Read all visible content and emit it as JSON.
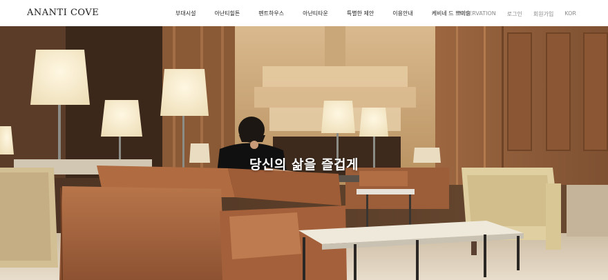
{
  "brand": {
    "logo_text": "ANANTI COVE"
  },
  "nav": {
    "items": [
      {
        "label": "부대시설"
      },
      {
        "label": "아난티힐튼"
      },
      {
        "label": "펜트하우스"
      },
      {
        "label": "아난티타운"
      },
      {
        "label": "특별한 제안"
      },
      {
        "label": "이용안내"
      },
      {
        "label": "케비네 드 쁘이송"
      }
    ]
  },
  "utility": {
    "reservation": "RESERVATION",
    "login": "로그인",
    "signup": "회원가입",
    "language": "KOR"
  },
  "hero": {
    "tagline": "당신의 삶을 즐겁게"
  },
  "colors": {
    "header_bg": "#ffffff",
    "nav_text": "#222222",
    "utility_text": "#8a8a8a",
    "wood": "#8a5a36",
    "leather": "#a9643d"
  }
}
